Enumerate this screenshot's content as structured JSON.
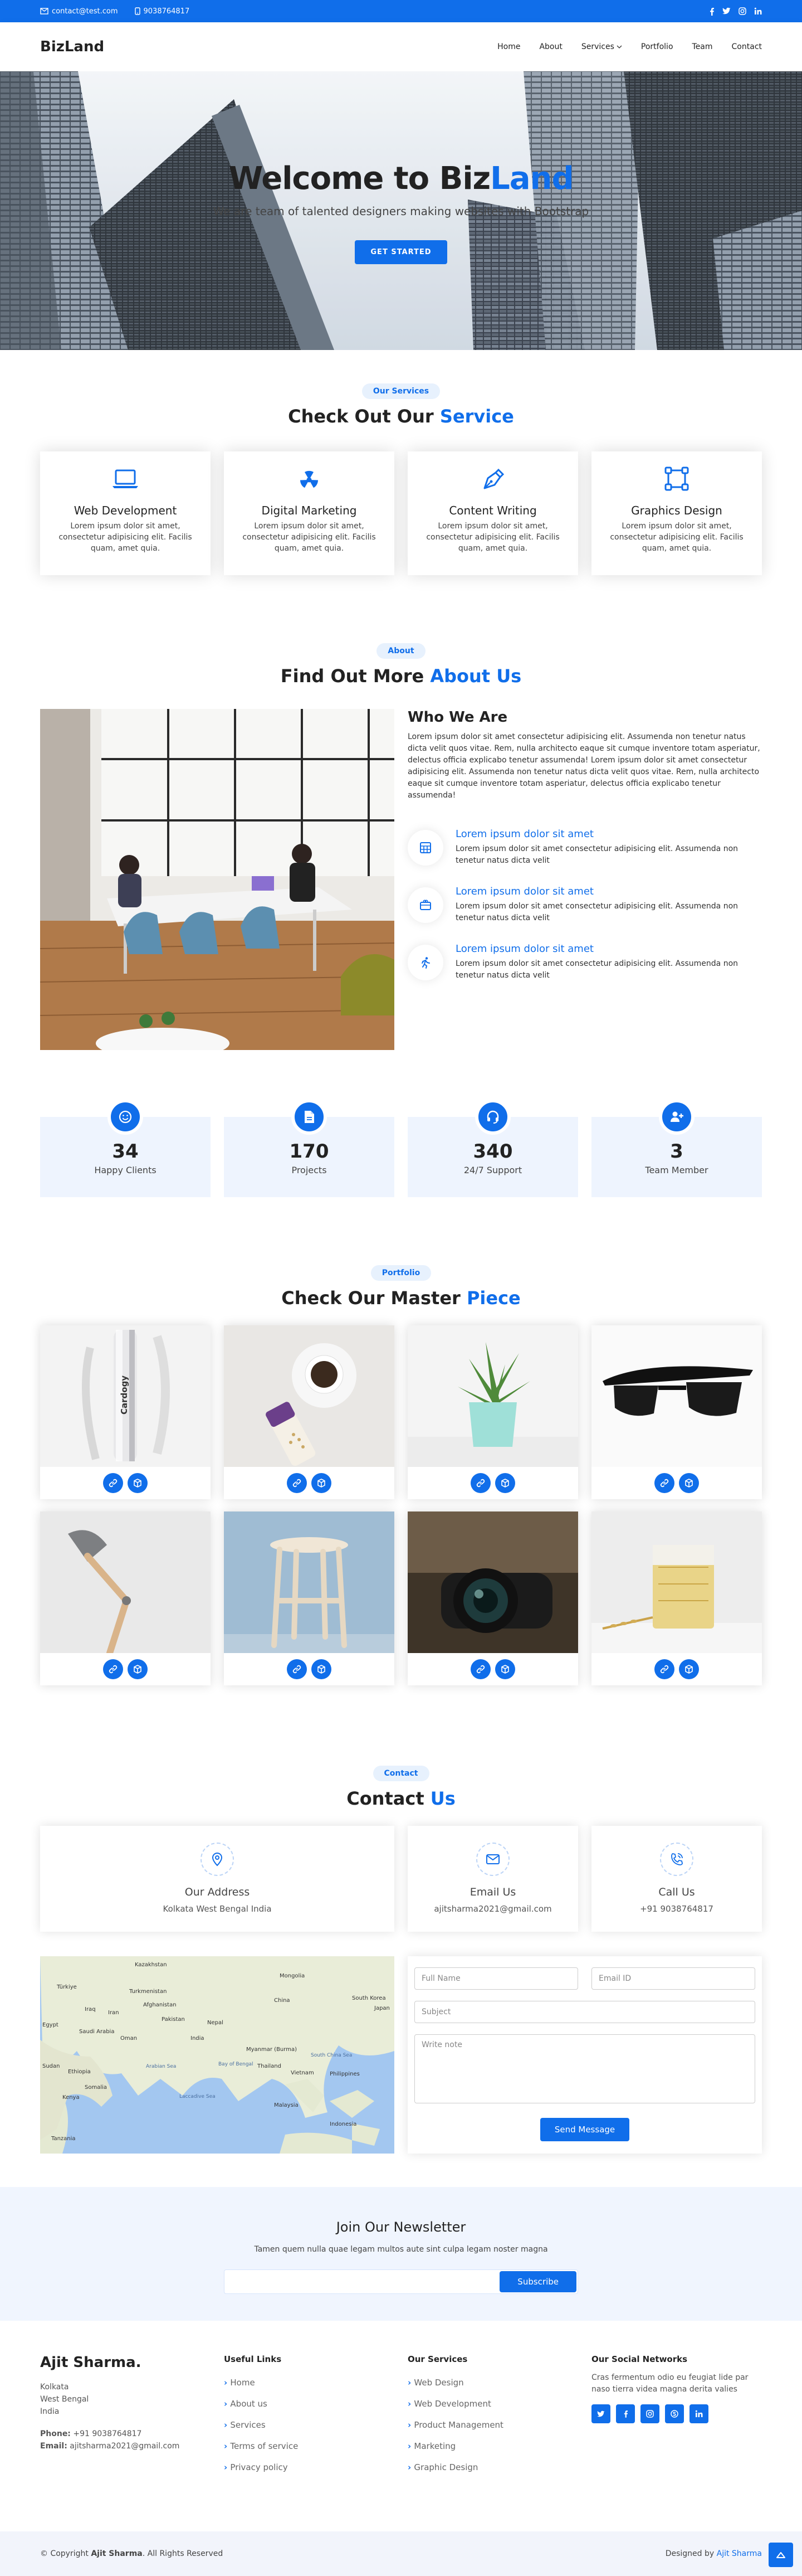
{
  "topbar": {
    "email": "contact@test.com",
    "phone": "9038764817",
    "social": [
      "facebook-icon",
      "twitter-icon",
      "instagram-icon",
      "linkedin-icon"
    ]
  },
  "header": {
    "logo": "BizLand",
    "nav": [
      "Home",
      "About",
      "Services",
      "Portfolio",
      "Team",
      "Contact"
    ]
  },
  "hero": {
    "title_a": "Welcome to Biz",
    "title_b": "Land",
    "subtitle": "We are team of talented designers making websites with Bootstrap",
    "cta": "GET STARTED"
  },
  "services": {
    "pill": "Our Services",
    "title_a": "Check Out Our ",
    "title_b": "Service",
    "items": [
      {
        "title": "Web Development",
        "text": "Lorem ipsum dolor sit amet, consectetur adipisicing elit. Facilis quam, amet quia."
      },
      {
        "title": "Digital Marketing",
        "text": "Lorem ipsum dolor sit amet, consectetur adipisicing elit. Facilis quam, amet quia."
      },
      {
        "title": "Content Writing",
        "text": "Lorem ipsum dolor sit amet, consectetur adipisicing elit. Facilis quam, amet quia."
      },
      {
        "title": "Graphics Design",
        "text": "Lorem ipsum dolor sit amet, consectetur adipisicing elit. Facilis quam, amet quia."
      }
    ]
  },
  "about": {
    "pill": "About",
    "title_a": "Find Out More ",
    "title_b": "About Us",
    "heading": "Who We Are",
    "para": "Lorem ipsum dolor sit amet consectetur adipisicing elit. Assumenda non tenetur natus dicta velit quos vitae. Rem, nulla architecto eaque sit cumque inventore totam asperiatur, delectus officia explicabo tenetur assumenda! Lorem ipsum dolor sit amet consectetur adipisicing elit. Assumenda non tenetur natus dicta velit quos vitae. Rem, nulla architecto eaque sit cumque inventore totam asperiatur, delectus officia explicabo tenetur assumenda!",
    "features": [
      {
        "title": "Lorem ipsum dolor sit amet",
        "text": "Lorem ipsum dolor sit amet consectetur adipisicing elit. Assumenda non tenetur natus dicta velit"
      },
      {
        "title": "Lorem ipsum dolor sit amet",
        "text": "Lorem ipsum dolor sit amet consectetur adipisicing elit. Assumenda non tenetur natus dicta velit"
      },
      {
        "title": "Lorem ipsum dolor sit amet",
        "text": "Lorem ipsum dolor sit amet consectetur adipisicing elit. Assumenda non tenetur natus dicta velit"
      }
    ]
  },
  "counts": [
    {
      "num": "34",
      "label": "Happy Clients"
    },
    {
      "num": "170",
      "label": "Projects"
    },
    {
      "num": "340",
      "label": "24/7 Support"
    },
    {
      "num": "3",
      "label": "Team Member"
    }
  ],
  "portfolio": {
    "pill": "Portfolio",
    "title_a": "Check Our Master ",
    "title_b": "Piece",
    "bottle_text": "Cardogy"
  },
  "contact": {
    "pill": "Contact",
    "title_a": "Contact ",
    "title_b": "Us",
    "address_h": "Our Address",
    "address": "Kolkata West Bengal India",
    "email_h": "Email Us",
    "email": "ajitsharma2021@gmail.com",
    "call_h": "Call Us",
    "phone": "+91 9038764817",
    "form": {
      "name": "Full Name",
      "email": "Email ID",
      "subject": "Subject",
      "note": "Write note",
      "send": "Send Message"
    },
    "map_labels": [
      "Kazakhstan",
      "Mongolia",
      "Türkiye",
      "Turkmenistan",
      "China",
      "South Korea",
      "Japan",
      "Afghanistan",
      "Iraq",
      "Iran",
      "Pakistan",
      "Nepal",
      "Egypt",
      "Saudi Arabia",
      "Oman",
      "India",
      "Myanmar (Burma)",
      "Thailand",
      "Vietnam",
      "Philippines",
      "Sudan",
      "Ethiopia",
      "Somalia",
      "Kenya",
      "Malaysia",
      "Indonesia",
      "Tanzania",
      "Arabian Sea",
      "Bay of Bengal",
      "Laccadive Sea",
      "South China Sea"
    ]
  },
  "newsletter": {
    "title": "Join Our Newsletter",
    "text": "Tamen quem nulla quae legam multos aute sint culpa legam noster magna",
    "btn": "Subscribe"
  },
  "footer": {
    "name": "Ajit Sharma.",
    "addr1": "Kolkata",
    "addr2": "West Bengal",
    "addr3": "India",
    "phone_l": "Phone:",
    "phone": "+91 9038764817",
    "email_l": "Email:",
    "email": "ajitsharma2021@gmail.com",
    "useful_h": "Useful Links",
    "useful": [
      "Home",
      "About us",
      "Services",
      "Terms of service",
      "Privacy policy"
    ],
    "services_h": "Our Services",
    "services": [
      "Web Design",
      "Web Development",
      "Product Management",
      "Marketing",
      "Graphic Design"
    ],
    "social_h": "Our Social Networks",
    "social_text": "Cras fermentum odio eu feugiat lide par naso tierra videa magna derita valies",
    "social_icons": [
      "twitter-icon",
      "facebook-icon",
      "instagram-icon",
      "skype-icon",
      "linkedin-icon"
    ],
    "copy_a": "© Copyright ",
    "copy_b": "Ajit Sharma",
    "copy_c": ". All Rights Reserved",
    "designed_a": "Designed by ",
    "designed_b": "Ajit Sharma"
  },
  "colors": {
    "accent": "#106eea",
    "light_bg": "#eef4fe"
  }
}
